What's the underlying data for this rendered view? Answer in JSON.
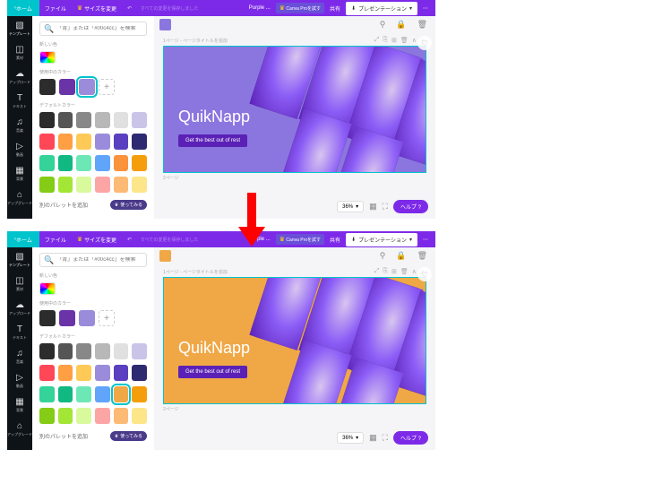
{
  "topbar": {
    "home": "ホーム",
    "file": "ファイル",
    "resize": "サイズを変更",
    "undo_hint": "すべての変更を保存しました",
    "doc_name": "Purple ...",
    "try_pro": "Canva Proを試す",
    "share": "共有",
    "present": "プレゼンテーション"
  },
  "rail": [
    {
      "label": "テンプレート",
      "icon": "▧"
    },
    {
      "label": "素材",
      "icon": "◫"
    },
    {
      "label": "アップロード",
      "icon": "☁"
    },
    {
      "label": "テキスト",
      "icon": "T"
    },
    {
      "label": "音楽",
      "icon": "♫"
    },
    {
      "label": "動画",
      "icon": "▷"
    },
    {
      "label": "背景",
      "icon": "▦"
    },
    {
      "label": "アップグレード",
      "icon": "⌂"
    }
  ],
  "panel": {
    "search_placeholder": "「青」または「#00c4cc」を検索",
    "new_color_label": "新しい色",
    "used_colors_label": "使用中のカラー",
    "default_colors_label": "デフォルトカラー",
    "palette_footer": "別のパレットを追加",
    "brand_btn": "使ってみる",
    "used": [
      "#2c2c2c",
      "#6a34a8",
      "#9b8cdb"
    ],
    "defaults": [
      [
        "#2c2c2c",
        "#555555",
        "#888888",
        "#b8b8b8",
        "#e0e0e0",
        "#c9c4e8"
      ],
      [
        "#ff4757",
        "#ff9f43",
        "#feca57",
        "#9b8cdb",
        "#5a3fc0",
        "#2e2a72"
      ],
      [
        "#34d399",
        "#10b981",
        "#6ee7b7",
        "#60a5fa",
        "#fb923c",
        "#f59e0b"
      ],
      [
        "#84cc16",
        "#a3e635",
        "#d9f99d",
        "#fca5a5",
        "#fdba74",
        "#fde68a"
      ]
    ]
  },
  "editor": {
    "page_title_hint": "1ページ - ページタイトルを追加",
    "page2": "2ページ",
    "zoom": "36%",
    "help": "ヘルプ ?"
  },
  "design": {
    "title": "QuikNapp",
    "cta": "Get the best out of rest"
  },
  "variant1": {
    "chip": "#8b76e0",
    "bg": "#8b76e0",
    "selected_used": 2
  },
  "variant2": {
    "chip": "#f0a847",
    "bg": "#f0a847",
    "selected_default": [
      3,
      4
    ]
  }
}
